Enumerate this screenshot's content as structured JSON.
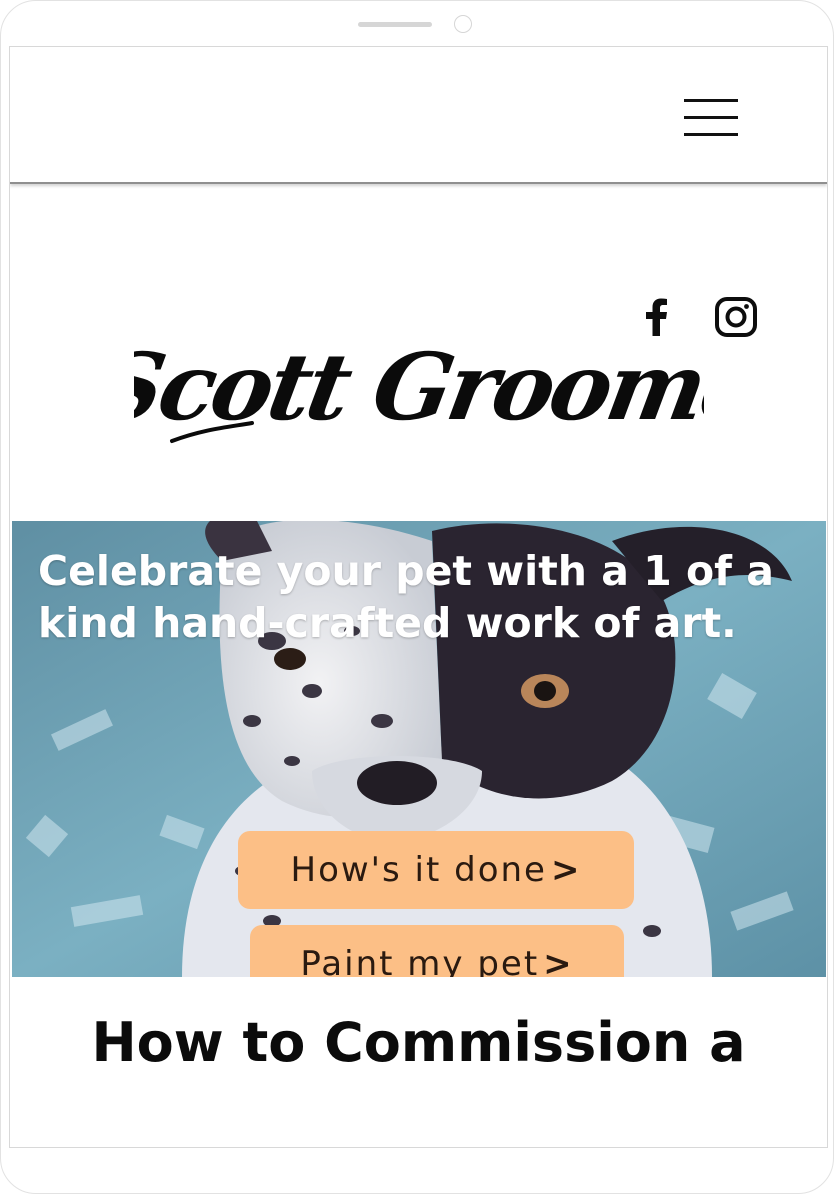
{
  "header": {
    "menu_icon": "hamburger-menu-icon"
  },
  "social": {
    "facebook_icon": "facebook-icon",
    "instagram_icon": "instagram-icon"
  },
  "logo": {
    "text": "Scott Groome"
  },
  "hero": {
    "heading": "Celebrate your pet with a 1 of a kind hand-crafted work of art.",
    "image": "painted-dog-portrait",
    "buttons": {
      "how_label": "How's it done",
      "paint_label": "Paint my pet",
      "chevron": ">"
    },
    "button_color": "#fcbf86",
    "background_color": "#6fa3b8"
  },
  "section": {
    "title": "How to Commission a"
  }
}
